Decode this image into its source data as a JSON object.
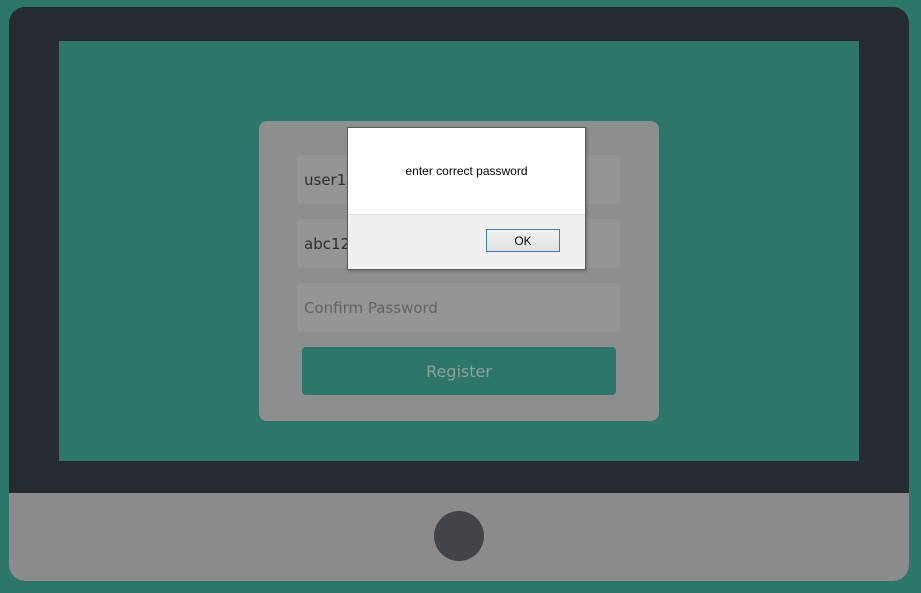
{
  "form": {
    "username_value": "user12",
    "password_value": "abc12",
    "confirm_placeholder": "Confirm Password",
    "register_label": "Register"
  },
  "alert": {
    "message": "enter correct password",
    "ok_label": "OK"
  },
  "colors": {
    "background": "#2c776a",
    "monitor_frame": "#262b32",
    "monitor_base": "#8b8b8d",
    "form_card": "#8d8e90",
    "register_button": "#2c776a"
  }
}
